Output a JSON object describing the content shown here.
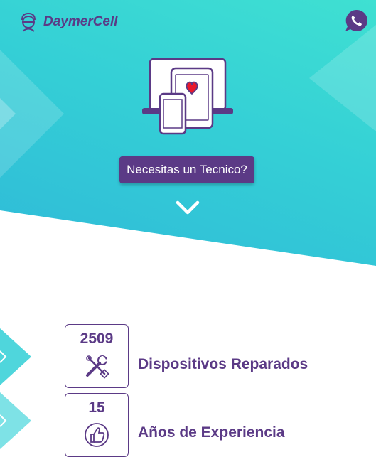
{
  "brand": {
    "name": "DaymerCell"
  },
  "hero": {
    "cta_label": "Necesitas un Tecnico?"
  },
  "stats": [
    {
      "number": "2509",
      "label": "Dispositivos Reparados",
      "icon": "tools-icon"
    },
    {
      "number": "15",
      "label": "Años de Experiencia",
      "icon": "thumbs-up-icon"
    }
  ],
  "colors": {
    "primary": "#5b3a86",
    "teal_light": "#3fe0d2",
    "teal_dark": "#2fb9d8",
    "whatsapp": "#5b3a86",
    "heart": "#e8192c"
  }
}
